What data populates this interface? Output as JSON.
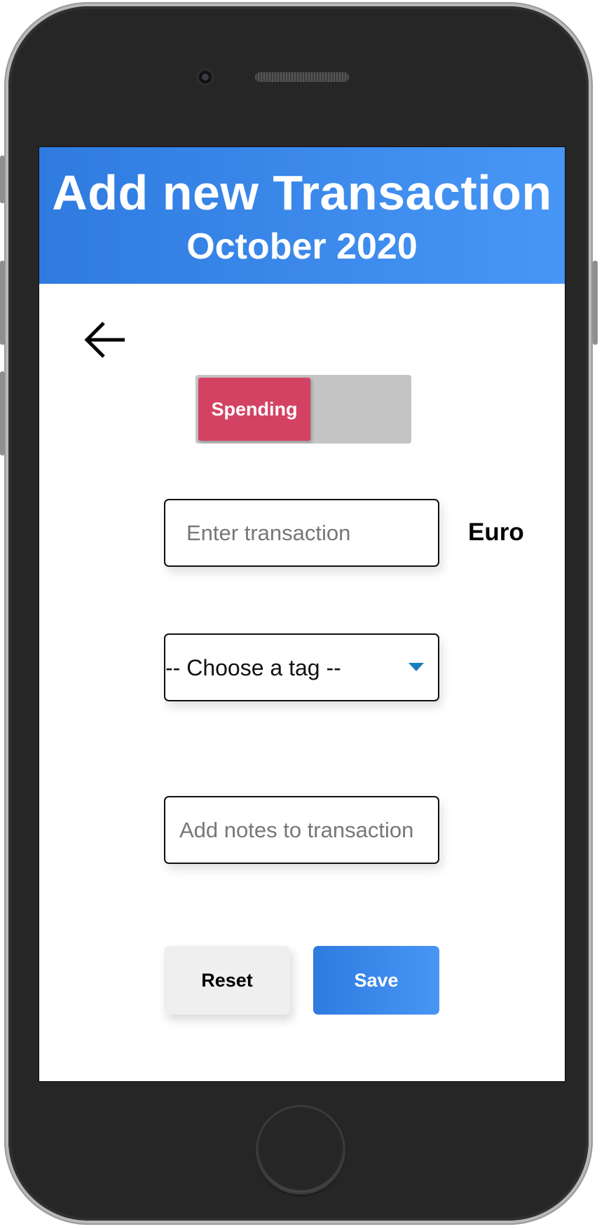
{
  "header": {
    "title": "Add new Transaction",
    "subtitle": "October 2020"
  },
  "navigation": {
    "back_icon": "arrow-left-icon"
  },
  "transaction_type_toggle": {
    "selected_label": "Spending"
  },
  "amount": {
    "value": "",
    "placeholder": "Enter transaction",
    "currency": "Euro"
  },
  "tag": {
    "selected": "-- Choose a tag --",
    "caret_icon": "caret-down-icon"
  },
  "notes": {
    "value": "",
    "placeholder": "Add notes to transaction"
  },
  "actions": {
    "reset_label": "Reset",
    "save_label": "Save"
  },
  "colors": {
    "header_blue": "#2f7be0",
    "spending_red": "#d44263",
    "toggle_gray": "#c4c4c4",
    "caret_blue": "#1b7cbf"
  }
}
